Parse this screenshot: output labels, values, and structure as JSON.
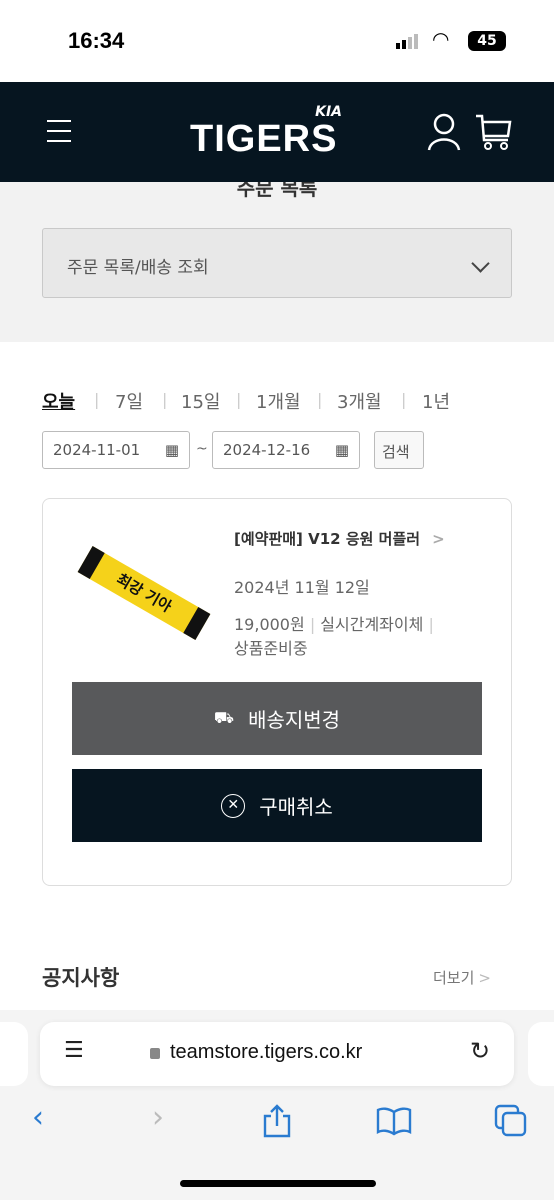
{
  "status": {
    "time": "16:34",
    "battery": "45"
  },
  "header": {
    "logo": "TIGERS",
    "logo_top": "KIA"
  },
  "page": {
    "title": "주문 목록",
    "dropdown": "주문 목록/배송 조회"
  },
  "periods": [
    "오늘",
    "7일",
    "15일",
    "1개월",
    "3개월",
    "1년"
  ],
  "filter": {
    "start": "2024-11-01",
    "tilde": "~",
    "end": "2024-12-16",
    "search": "검색"
  },
  "order": {
    "title": "[예약판매] V12 응원 머플러",
    "date": "2024년 11월 12일",
    "price": "19,000원",
    "payment": "실시간계좌이체",
    "status": "상품준비중",
    "image_text": "최강 기아",
    "change_address": "배송지변경",
    "cancel": "구매취소"
  },
  "notice": {
    "title": "공지사항",
    "more": "더보기"
  },
  "browser": {
    "url": "teamstore.tigers.co.kr"
  },
  "colors": {
    "header": "#061520",
    "gray_button": "#58595b",
    "dark_button": "#061520",
    "link": "#2a7bd0"
  }
}
